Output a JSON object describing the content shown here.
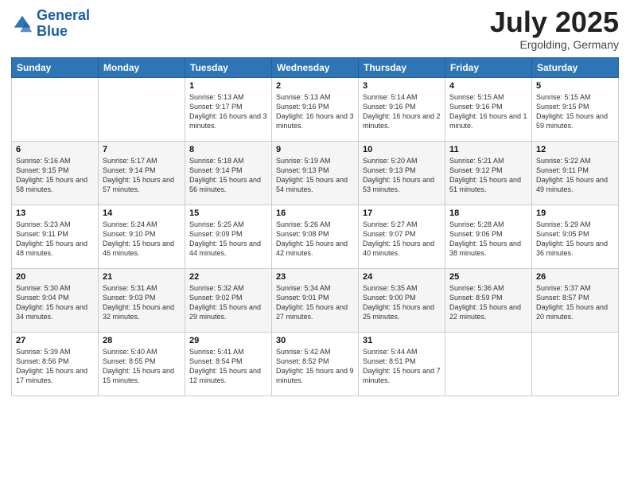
{
  "header": {
    "logo_line1": "General",
    "logo_line2": "Blue",
    "month": "July 2025",
    "location": "Ergolding, Germany"
  },
  "weekdays": [
    "Sunday",
    "Monday",
    "Tuesday",
    "Wednesday",
    "Thursday",
    "Friday",
    "Saturday"
  ],
  "weeks": [
    [
      {
        "day": "",
        "info": ""
      },
      {
        "day": "",
        "info": ""
      },
      {
        "day": "1",
        "info": "Sunrise: 5:13 AM\nSunset: 9:17 PM\nDaylight: 16 hours and 3 minutes."
      },
      {
        "day": "2",
        "info": "Sunrise: 5:13 AM\nSunset: 9:16 PM\nDaylight: 16 hours and 3 minutes."
      },
      {
        "day": "3",
        "info": "Sunrise: 5:14 AM\nSunset: 9:16 PM\nDaylight: 16 hours and 2 minutes."
      },
      {
        "day": "4",
        "info": "Sunrise: 5:15 AM\nSunset: 9:16 PM\nDaylight: 16 hours and 1 minute."
      },
      {
        "day": "5",
        "info": "Sunrise: 5:15 AM\nSunset: 9:15 PM\nDaylight: 15 hours and 59 minutes."
      }
    ],
    [
      {
        "day": "6",
        "info": "Sunrise: 5:16 AM\nSunset: 9:15 PM\nDaylight: 15 hours and 58 minutes."
      },
      {
        "day": "7",
        "info": "Sunrise: 5:17 AM\nSunset: 9:14 PM\nDaylight: 15 hours and 57 minutes."
      },
      {
        "day": "8",
        "info": "Sunrise: 5:18 AM\nSunset: 9:14 PM\nDaylight: 15 hours and 56 minutes."
      },
      {
        "day": "9",
        "info": "Sunrise: 5:19 AM\nSunset: 9:13 PM\nDaylight: 15 hours and 54 minutes."
      },
      {
        "day": "10",
        "info": "Sunrise: 5:20 AM\nSunset: 9:13 PM\nDaylight: 15 hours and 53 minutes."
      },
      {
        "day": "11",
        "info": "Sunrise: 5:21 AM\nSunset: 9:12 PM\nDaylight: 15 hours and 51 minutes."
      },
      {
        "day": "12",
        "info": "Sunrise: 5:22 AM\nSunset: 9:11 PM\nDaylight: 15 hours and 49 minutes."
      }
    ],
    [
      {
        "day": "13",
        "info": "Sunrise: 5:23 AM\nSunset: 9:11 PM\nDaylight: 15 hours and 48 minutes."
      },
      {
        "day": "14",
        "info": "Sunrise: 5:24 AM\nSunset: 9:10 PM\nDaylight: 15 hours and 46 minutes."
      },
      {
        "day": "15",
        "info": "Sunrise: 5:25 AM\nSunset: 9:09 PM\nDaylight: 15 hours and 44 minutes."
      },
      {
        "day": "16",
        "info": "Sunrise: 5:26 AM\nSunset: 9:08 PM\nDaylight: 15 hours and 42 minutes."
      },
      {
        "day": "17",
        "info": "Sunrise: 5:27 AM\nSunset: 9:07 PM\nDaylight: 15 hours and 40 minutes."
      },
      {
        "day": "18",
        "info": "Sunrise: 5:28 AM\nSunset: 9:06 PM\nDaylight: 15 hours and 38 minutes."
      },
      {
        "day": "19",
        "info": "Sunrise: 5:29 AM\nSunset: 9:05 PM\nDaylight: 15 hours and 36 minutes."
      }
    ],
    [
      {
        "day": "20",
        "info": "Sunrise: 5:30 AM\nSunset: 9:04 PM\nDaylight: 15 hours and 34 minutes."
      },
      {
        "day": "21",
        "info": "Sunrise: 5:31 AM\nSunset: 9:03 PM\nDaylight: 15 hours and 32 minutes."
      },
      {
        "day": "22",
        "info": "Sunrise: 5:32 AM\nSunset: 9:02 PM\nDaylight: 15 hours and 29 minutes."
      },
      {
        "day": "23",
        "info": "Sunrise: 5:34 AM\nSunset: 9:01 PM\nDaylight: 15 hours and 27 minutes."
      },
      {
        "day": "24",
        "info": "Sunrise: 5:35 AM\nSunset: 9:00 PM\nDaylight: 15 hours and 25 minutes."
      },
      {
        "day": "25",
        "info": "Sunrise: 5:36 AM\nSunset: 8:59 PM\nDaylight: 15 hours and 22 minutes."
      },
      {
        "day": "26",
        "info": "Sunrise: 5:37 AM\nSunset: 8:57 PM\nDaylight: 15 hours and 20 minutes."
      }
    ],
    [
      {
        "day": "27",
        "info": "Sunrise: 5:39 AM\nSunset: 8:56 PM\nDaylight: 15 hours and 17 minutes."
      },
      {
        "day": "28",
        "info": "Sunrise: 5:40 AM\nSunset: 8:55 PM\nDaylight: 15 hours and 15 minutes."
      },
      {
        "day": "29",
        "info": "Sunrise: 5:41 AM\nSunset: 8:54 PM\nDaylight: 15 hours and 12 minutes."
      },
      {
        "day": "30",
        "info": "Sunrise: 5:42 AM\nSunset: 8:52 PM\nDaylight: 15 hours and 9 minutes."
      },
      {
        "day": "31",
        "info": "Sunrise: 5:44 AM\nSunset: 8:51 PM\nDaylight: 15 hours and 7 minutes."
      },
      {
        "day": "",
        "info": ""
      },
      {
        "day": "",
        "info": ""
      }
    ]
  ]
}
